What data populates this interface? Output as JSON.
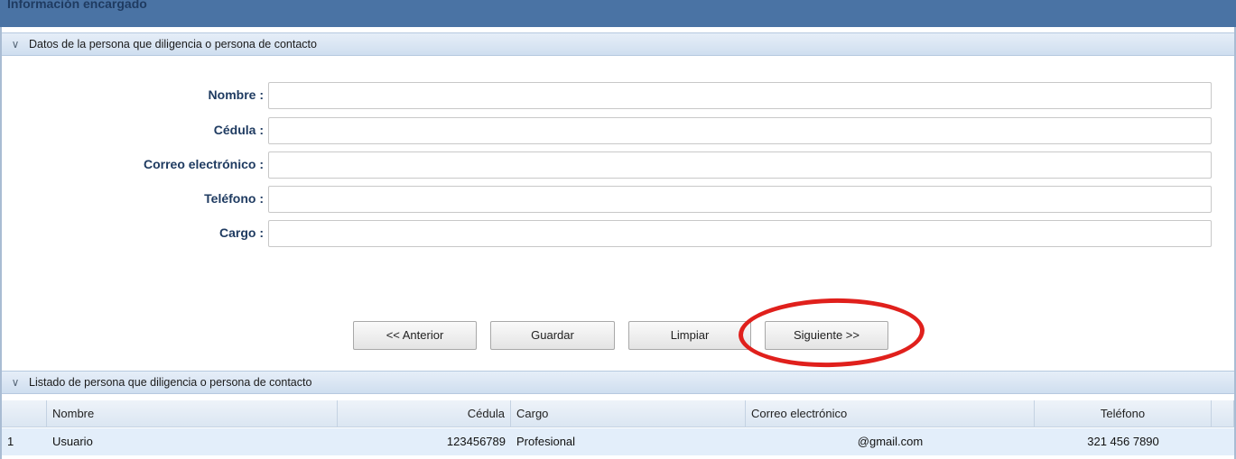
{
  "window": {
    "title": "Información encargado"
  },
  "contact_panel": {
    "title": "Datos de la persona que diligencia o persona de contacto",
    "fields": [
      {
        "label": "Nombre :",
        "value": ""
      },
      {
        "label": "Cédula :",
        "value": ""
      },
      {
        "label": "Correo electrónico :",
        "value": ""
      },
      {
        "label": "Teléfono :",
        "value": ""
      },
      {
        "label": "Cargo :",
        "value": ""
      }
    ]
  },
  "buttons": {
    "previous": "<< Anterior",
    "save": "Guardar",
    "clear": "Limpiar",
    "next": "Siguiente >>"
  },
  "list_panel": {
    "title": "Listado de persona que diligencia o persona de contacto",
    "columns": [
      "",
      "Nombre",
      "Cédula",
      "Cargo",
      "Correo electrónico",
      "Teléfono"
    ],
    "rows": [
      {
        "index": "1",
        "nombre": "Usuario",
        "cedula": "123456789",
        "cargo": "Profesional",
        "correo": "@gmail.com",
        "telefono": "321 456 7890"
      }
    ]
  },
  "colors": {
    "header": "#4a73a4",
    "label": "#1f3b61",
    "highlight": "#e0201c",
    "row": "#e3eefa"
  },
  "icons": {
    "collapse": "chevron-down-icon"
  }
}
